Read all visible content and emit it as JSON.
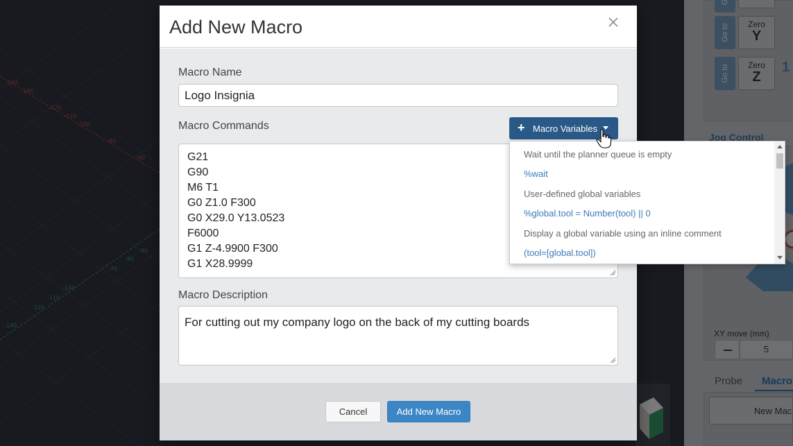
{
  "modal": {
    "title": "Add New Macro",
    "close_icon": "close-icon",
    "name_label": "Macro Name",
    "name_value": "Logo Insignia",
    "commands_label": "Macro Commands",
    "macro_variables_label": "Macro Variables",
    "commands": [
      "G21",
      "G90",
      "M6 T1",
      "G0 Z1.0 F300",
      "G0 X29.0 Y13.0523",
      "F6000",
      "G1 Z-4.9900 F300",
      "G1 X28.9999"
    ],
    "description_label": "Macro Description",
    "description_value": "For cutting out my company logo on the back of my cutting boards",
    "cancel_label": "Cancel",
    "submit_label": "Add New Macro"
  },
  "dropdown": {
    "items": [
      {
        "type": "header",
        "text": "Wait until the planner queue is empty"
      },
      {
        "type": "link",
        "text": "%wait"
      },
      {
        "type": "header",
        "text": "User-defined global variables"
      },
      {
        "type": "link",
        "text": "%global.tool = Number(tool) || 0"
      },
      {
        "type": "header",
        "text": "Display a global variable using an inline comment"
      },
      {
        "type": "link",
        "text": "(tool=[global.tool])"
      }
    ]
  },
  "right_panel": {
    "goto_label": "Go to",
    "zero_label": "Zero",
    "axes": [
      "X",
      "Y",
      "Z"
    ],
    "axis_value_partial": "1",
    "jog_control_label": "Jog Control",
    "xy_move_label": "XY move (mm)",
    "xy_move_value": "5",
    "minus_icon": "minus-icon",
    "tabs": [
      "Probe",
      "Macro"
    ],
    "new_macro_label": "New Mac"
  },
  "viewport": {
    "ticks_x": [
      "-150",
      "-140",
      "-130",
      "-120",
      "-110",
      "-100",
      "-90",
      "-80",
      "-70",
      "-60"
    ],
    "ticks_y": [
      "-150",
      "-140",
      "-130",
      "-120",
      "-110",
      "-100",
      "-90",
      "-80",
      "-70"
    ],
    "x_axis_color": "#c0443f",
    "y_axis_color": "#3d9a6a"
  },
  "colors": {
    "primary": "#3c86c6",
    "dark_primary": "#2a5887",
    "link": "#3a7ab6"
  }
}
